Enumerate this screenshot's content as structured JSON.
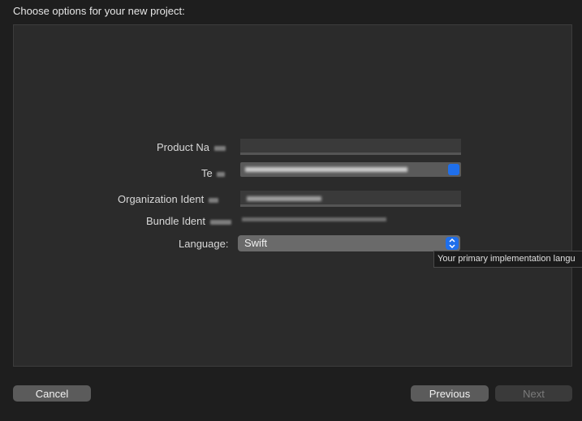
{
  "dialog": {
    "title": "Choose options for your new project:"
  },
  "form": {
    "product_name_label": "Product Na",
    "team_label": "Te",
    "organization_label": "Organization Ident",
    "bundle_label": "Bundle Ident",
    "language_label": "Language:",
    "language_value": "Swift",
    "tooltip_text": "Your primary implementation langu"
  },
  "buttons": {
    "cancel": "Cancel",
    "previous": "Previous",
    "next": "Next"
  },
  "icons": {
    "chevron_up_down": "chevron-up-down-icon"
  }
}
